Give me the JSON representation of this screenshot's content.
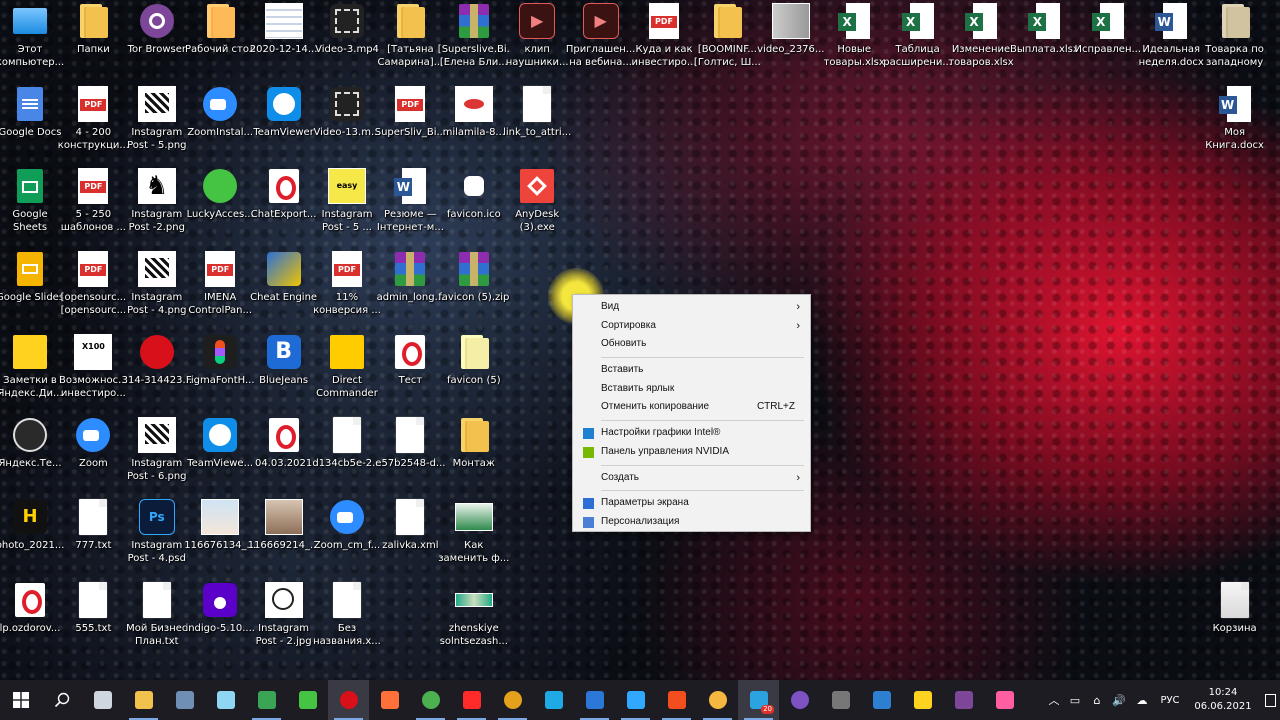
{
  "desktop": {
    "icons": [
      {
        "label": "Этот компьютер...",
        "type": "pc"
      },
      {
        "label": "Папки",
        "type": "folder"
      },
      {
        "label": "Tor Browser",
        "type": "tor"
      },
      {
        "label": "Рабочий стол",
        "type": "folder-doc"
      },
      {
        "label": "2020-12-14...",
        "type": "screenshot"
      },
      {
        "label": "Video-3.mp4",
        "type": "video"
      },
      {
        "label": "[Татьяна Самарина]...",
        "type": "folder"
      },
      {
        "label": "[Superslive.Bi... [Елена Бли...",
        "type": "rar"
      },
      {
        "label": "клип наушники...",
        "type": "video-red"
      },
      {
        "label": "Приглашен... на вебина...",
        "type": "video-red"
      },
      {
        "label": "Куда и как инвестиро...",
        "type": "pdf"
      },
      {
        "label": "[BOOMINF... [Голтис, Ш...",
        "type": "folder"
      },
      {
        "label": "video_2376...",
        "type": "photo"
      },
      {
        "label": "Новые товары.xlsx",
        "type": "xls"
      },
      {
        "label": "Таблица расширени...",
        "type": "xls"
      },
      {
        "label": "Изменение товаров.xlsx",
        "type": "xls"
      },
      {
        "label": "Выплата.xlsx",
        "type": "xls"
      },
      {
        "label": "Исправлен...",
        "type": "xls"
      },
      {
        "label": "Идеальная неделя.docx",
        "type": "doc"
      },
      {
        "label": "Товарка по западному",
        "type": "folder-gray"
      },
      {
        "label": "Google Docs",
        "type": "gdocs"
      },
      {
        "label": "4 - 200 конструкци...",
        "type": "pdf"
      },
      {
        "label": "Instagram Post - 5.png",
        "type": "img-bw"
      },
      {
        "label": "ZoomInstal...",
        "type": "zoom"
      },
      {
        "label": "TeamViewer",
        "type": "teamviewer"
      },
      {
        "label": "Video-13.m...",
        "type": "video"
      },
      {
        "label": "SuperSliv_Bi...",
        "type": "pdf"
      },
      {
        "label": "milamila-8...",
        "type": "img-lips"
      },
      {
        "label": "link_to_attri...",
        "type": "file"
      },
      {
        "label": "Моя Книга.docx",
        "type": "doc"
      },
      {
        "label": "Google Sheets",
        "type": "gsheets"
      },
      {
        "label": "5 - 250 шаблонов ...",
        "type": "pdf"
      },
      {
        "label": "Instagram Post -2.png",
        "type": "img-horse"
      },
      {
        "label": "LuckyAcces...",
        "type": "clover"
      },
      {
        "label": "ChatExport...",
        "type": "opera"
      },
      {
        "label": "Instagram Post - 5 ...",
        "type": "img-easy"
      },
      {
        "label": "Резюме — Інтернет-м...",
        "type": "doc"
      },
      {
        "label": "favicon.ico",
        "type": "favicon"
      },
      {
        "label": "AnyDesk (3).exe",
        "type": "anydesk"
      },
      {
        "label": "Google Slides",
        "type": "gslides"
      },
      {
        "label": "[opensourc... [opensourc...",
        "type": "pdf"
      },
      {
        "label": "Instagram Post - 4.png",
        "type": "img-bw"
      },
      {
        "label": "IMENA ControlPan...",
        "type": "pdf"
      },
      {
        "label": "Cheat Engine",
        "type": "cheat"
      },
      {
        "label": "11% конверсия ...",
        "type": "pdf"
      },
      {
        "label": "admin_long...",
        "type": "rar"
      },
      {
        "label": "favicon (5).zip",
        "type": "rar"
      },
      {
        "label": "Заметки в Яндекс.Ди...",
        "type": "yanotes"
      },
      {
        "label": "Возможнос... инвестиро...",
        "type": "img-x100"
      },
      {
        "label": "314-314423...",
        "type": "red-dot"
      },
      {
        "label": "FigmaFontH...",
        "type": "figma"
      },
      {
        "label": "BlueJeans",
        "type": "bluejeans"
      },
      {
        "label": "Direct Commander",
        "type": "direct"
      },
      {
        "label": "Тест",
        "type": "opera"
      },
      {
        "label": "favicon (5)",
        "type": "folder-white"
      },
      {
        "label": "Яндекс.Те...",
        "type": "yatelemost"
      },
      {
        "label": "Zoom",
        "type": "zoom"
      },
      {
        "label": "Instagram Post - 6.png",
        "type": "img-bw"
      },
      {
        "label": "TeamViewe...",
        "type": "teamviewer"
      },
      {
        "label": "04.03.2021",
        "type": "opera"
      },
      {
        "label": "d134cb5e-2...",
        "type": "file"
      },
      {
        "label": "e57b2548-d...",
        "type": "file"
      },
      {
        "label": "Монтаж",
        "type": "folder"
      },
      {
        "label": "photo_2021...",
        "type": "photo-h"
      },
      {
        "label": "777.txt",
        "type": "file"
      },
      {
        "label": "Instagram Post - 4.psd",
        "type": "psd"
      },
      {
        "label": "116676134_...",
        "type": "photo-person"
      },
      {
        "label": "116669214_...",
        "type": "photo-hand"
      },
      {
        "label": "Zoom_cm_f...",
        "type": "zoom"
      },
      {
        "label": "zalivka.xml",
        "type": "file"
      },
      {
        "label": "Как заменить ф...",
        "type": "video-thumb"
      },
      {
        "label": "lp.ozdorov...",
        "type": "opera"
      },
      {
        "label": "555.txt",
        "type": "file"
      },
      {
        "label": "Мой Бизнес План.txt",
        "type": "file"
      },
      {
        "label": "indigo-5.10....",
        "type": "indigo"
      },
      {
        "label": "Instagram Post - 2.jpg",
        "type": "img-face"
      },
      {
        "label": "Без названия.х...",
        "type": "file"
      },
      {
        "label": "zhenskiye solntsezash...",
        "type": "img-strip"
      },
      {
        "label": "Корзина",
        "type": "recycle"
      }
    ]
  },
  "context_menu": {
    "items": [
      {
        "label": "Вид",
        "submenu": true
      },
      {
        "label": "Сортировка",
        "submenu": true
      },
      {
        "label": "Обновить"
      },
      {
        "label": "Вставить"
      },
      {
        "label": "Вставить ярлык"
      },
      {
        "label": "Отменить копирование",
        "shortcut": "CTRL+Z"
      },
      {
        "label": "Настройки графики Intel®",
        "icon": "intel-icon"
      },
      {
        "label": "Панель управления NVIDIA",
        "icon": "nvidia-icon"
      },
      {
        "label": "Создать",
        "submenu": true
      },
      {
        "label": "Параметры экрана",
        "icon": "display-icon"
      },
      {
        "label": "Персонализация",
        "icon": "personalize-icon"
      }
    ]
  },
  "taskbar": {
    "apps": [
      {
        "name": "task-view-icon"
      },
      {
        "name": "file-explorer-icon"
      },
      {
        "name": "calculator-icon"
      },
      {
        "name": "notes-icon"
      },
      {
        "name": "cheat-engine-icon"
      },
      {
        "name": "clover-icon"
      },
      {
        "name": "opera-icon"
      },
      {
        "name": "firefox-icon"
      },
      {
        "name": "chrome-icon"
      },
      {
        "name": "yandex-icon"
      },
      {
        "name": "opera-gx-icon"
      },
      {
        "name": "edge-icon"
      },
      {
        "name": "network-app-icon"
      },
      {
        "name": "photoshop-icon"
      },
      {
        "name": "figma-icon"
      },
      {
        "name": "aperture-icon"
      },
      {
        "name": "telegram-icon"
      },
      {
        "name": "viber-icon"
      },
      {
        "name": "world-of-tanks-icon"
      },
      {
        "name": "screen-icon"
      },
      {
        "name": "sticky-notes-icon"
      },
      {
        "name": "tor-icon"
      },
      {
        "name": "colorful-app-icon"
      }
    ],
    "telegram_badge": "20",
    "language": "РУС",
    "time": "10:24",
    "date": "06.06.2021"
  }
}
